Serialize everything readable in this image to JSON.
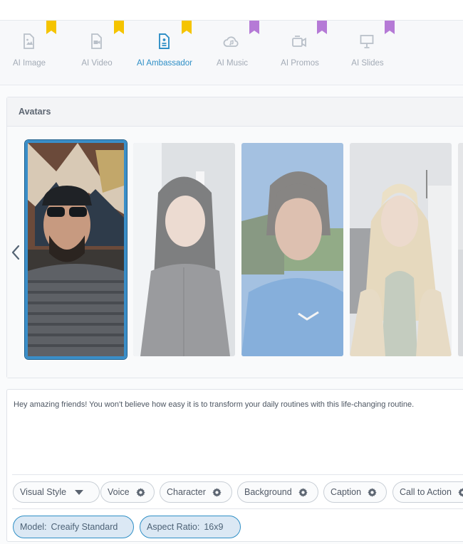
{
  "tabs": [
    {
      "label": "AI Image",
      "icon": "image-file-icon",
      "badge_color": "#f5c400",
      "active": false
    },
    {
      "label": "AI Video",
      "icon": "video-file-icon",
      "badge_color": "#f5c400",
      "active": false
    },
    {
      "label": "AI Ambassador",
      "icon": "document-person-icon",
      "badge_color": "#f5c400",
      "active": true
    },
    {
      "label": "AI Music",
      "icon": "cloud-music-icon",
      "badge_color": "#b57ad6",
      "active": false
    },
    {
      "label": "AI Promos",
      "icon": "video-camera-icon",
      "badge_color": "#b57ad6",
      "active": false
    },
    {
      "label": "AI Slides",
      "icon": "presentation-icon",
      "badge_color": "#b57ad6",
      "active": false
    }
  ],
  "avatars_panel": {
    "title": "Avatars",
    "items": [
      {
        "name": "avatar-man-sunglasses-beard",
        "selected": true
      },
      {
        "name": "avatar-woman-gray-shirt",
        "selected": false
      },
      {
        "name": "avatar-woman-blue-sweater",
        "selected": false
      },
      {
        "name": "avatar-woman-blonde",
        "selected": false
      },
      {
        "name": "avatar-partial",
        "selected": false
      }
    ]
  },
  "script": {
    "text": "Hey amazing friends! You won't believe how easy it is to transform your daily routines with this life-changing routine."
  },
  "options": [
    {
      "label": "Visual Style",
      "control": "dropdown"
    },
    {
      "label": "Voice",
      "control": "gear"
    },
    {
      "label": "Character",
      "control": "gear"
    },
    {
      "label": "Background",
      "control": "gear"
    },
    {
      "label": "Caption",
      "control": "gear"
    },
    {
      "label": "Call to Action",
      "control": "gear"
    }
  ],
  "settings": {
    "model": {
      "key": "Model:",
      "value": "Creaify Standard"
    },
    "aspect_ratio": {
      "key": "Aspect Ratio:",
      "value": "16x9"
    }
  },
  "colors": {
    "accent": "#2f8fc6",
    "premium_gold": "#f5c400",
    "premium_purple": "#b57ad6"
  }
}
